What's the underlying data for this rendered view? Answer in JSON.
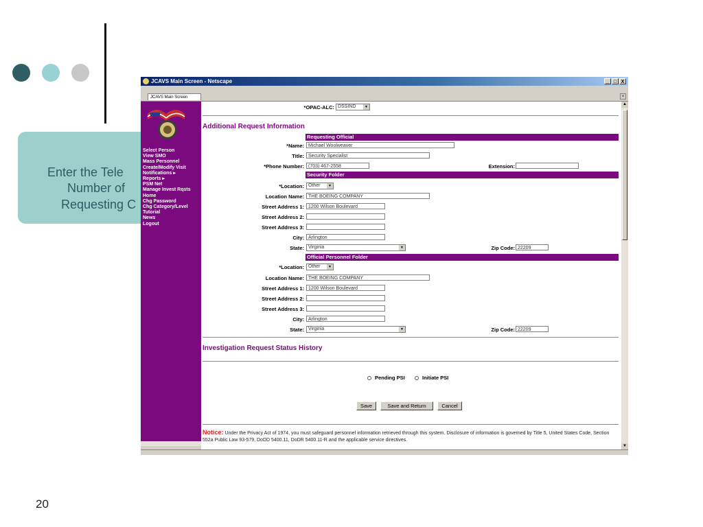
{
  "slide": {
    "page_number": "20",
    "dots": [
      "#2e5d63",
      "#99d2d2",
      "#c8c8c8"
    ],
    "callout_lines": [
      "Enter the Tele",
      "Number of",
      "Requesting C"
    ]
  },
  "window": {
    "title": "JCAVS Main Screen - Netscape",
    "tab": "JCAVS Main Screen",
    "buttons": [
      "_",
      "□",
      "X"
    ]
  },
  "sidebar": {
    "items": [
      "Select Person",
      "View SMO",
      "Mass Personnel",
      "Create/Modify Visit",
      "Notifications ▸",
      "Reports ▸",
      "PSM Net",
      "Manage Invest Rqsts",
      "Home",
      "Chg Password",
      "Chg Category/Level",
      "Tutorial",
      "News",
      "Logout"
    ]
  },
  "form": {
    "opac_label": "*OPAC-ALC:",
    "opac_value": "DSSIND",
    "section_additional": "Additional Request Information",
    "requesting_official": {
      "bar": "Requesting Official",
      "name_label": "*Name:",
      "name_value": "Michael Woolweaver",
      "title_label": "Title:",
      "title_value": "Security Specialist",
      "phone_label": "*Phone Number:",
      "phone_value": "(703) 467-2558",
      "ext_label": "Extension:",
      "ext_value": ""
    },
    "security_folder": {
      "bar": "Security Folder",
      "location_label": "*Location:",
      "location_value": "Other",
      "locname_label": "Location Name:",
      "locname_value": "THE BOEING COMPANY",
      "addr1_label": "Street Address 1:",
      "addr1_value": "1200 Wilson Boulevard",
      "addr2_label": "Street Address 2:",
      "addr2_value": "",
      "addr3_label": "Street Address 3:",
      "addr3_value": "",
      "city_label": "City:",
      "city_value": "Arlington",
      "state_label": "State:",
      "state_value": "Virginia",
      "zip_label": "Zip Code:",
      "zip_value": "22209"
    },
    "official_folder": {
      "bar": "Official Personnel Folder",
      "location_label": "*Location:",
      "location_value": "Other",
      "locname_label": "Location Name:",
      "locname_value": "THE BOEING COMPANY",
      "addr1_label": "Street Address 1:",
      "addr1_value": "1200 Wilson Boulevard",
      "addr2_label": "Street Address 2:",
      "addr2_value": "",
      "addr3_label": "Street Address 3:",
      "addr3_value": "",
      "city_label": "City:",
      "city_value": "Arlington",
      "state_label": "State:",
      "state_value": "Virginia",
      "zip_label": "Zip Code:",
      "zip_value": "22209"
    },
    "section_history": "Investigation Request Status History",
    "radio_pending": "Pending PSI",
    "radio_initiate": "Initiate PSI",
    "btn_save": "Save",
    "btn_save_return": "Save and Return",
    "btn_cancel": "Cancel",
    "notice_head": "Notice:",
    "notice_text": " Under the Privacy Act of 1974, you must safeguard personnel information retrieved through this system. Disclosure of information is governed by Title 5, United States Code, Section 552a Public Law 93-579, DoDD 5400.11, DoDR 5400.11-R and the applicable service directives."
  }
}
